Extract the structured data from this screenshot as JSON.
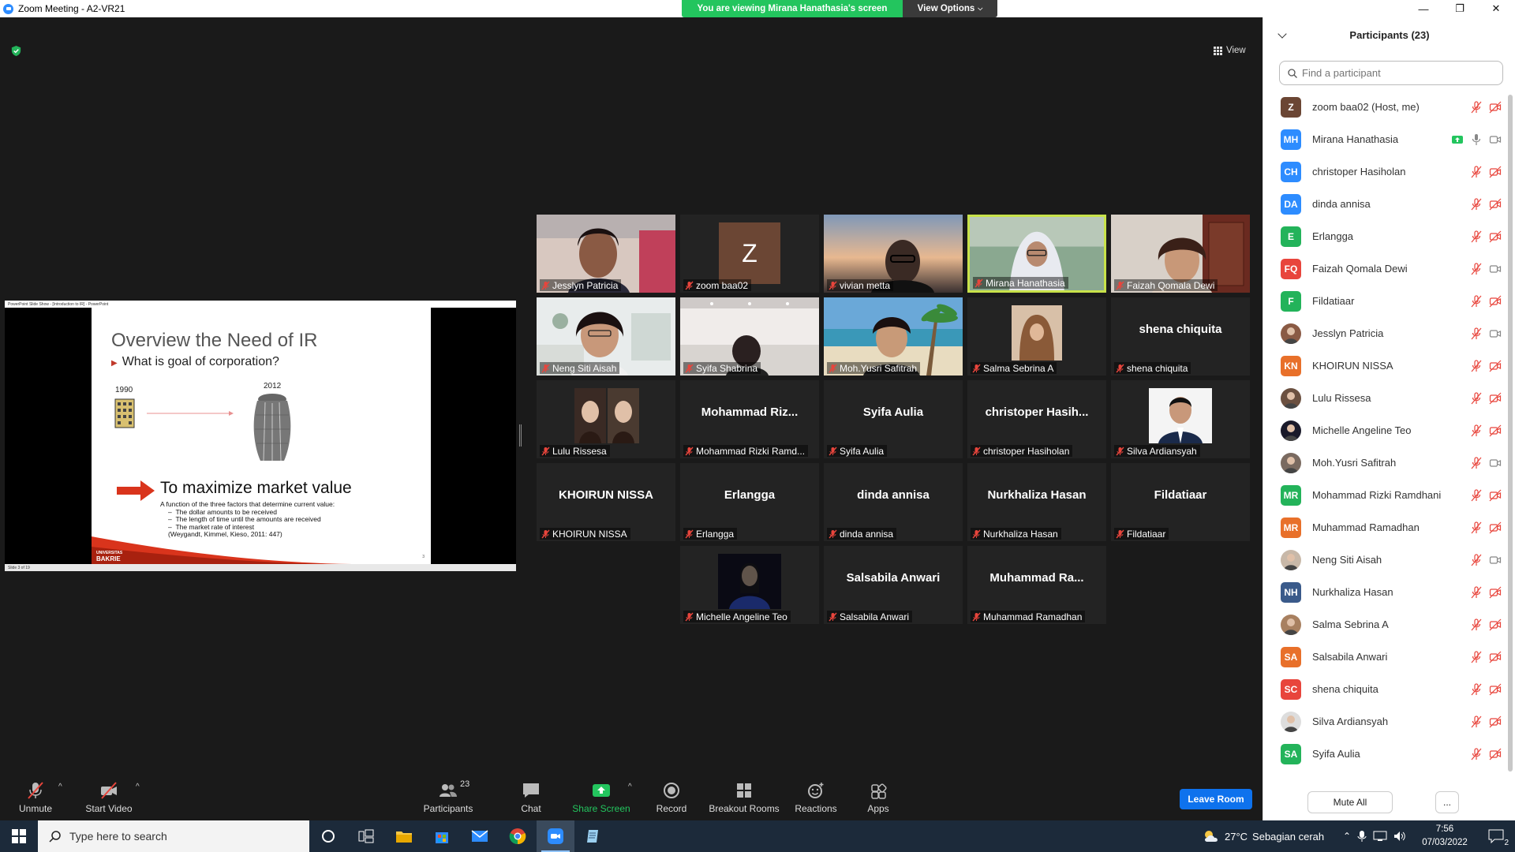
{
  "window": {
    "title": "Zoom Meeting - A2-VR21",
    "minimize": "—",
    "maximize": "❐",
    "close": "✕"
  },
  "banner": {
    "viewing": "You are viewing Mirana Hanathasia's screen",
    "view_options": "View Options"
  },
  "view_button": "View",
  "shared_screen": {
    "window_caption": "PowerPoint Slide Show - [Introduction to IR] - PowerPoint",
    "status": "Slide 3 of 19",
    "slide": {
      "title": "Overview the Need of IR",
      "bullet": "What is goal of corporation?",
      "year_left": "1990",
      "year_right": "2012",
      "headline": "To maximize market value",
      "description": "A function of the three factors that determine current value:",
      "points": [
        "The dollar amounts to be received",
        "The length of time until the amounts are received",
        "The market rate of interest"
      ],
      "citation": "(Weygandt, Kimmel, Kieso, 2011: 447)",
      "logo_line1": "UNIVERSITAS",
      "logo_line2": "BAKRIE",
      "page_number": "3"
    }
  },
  "gallery": [
    {
      "label": "Jesslyn Patricia",
      "kind": "video",
      "scene": "warm"
    },
    {
      "label": "zoom baa02",
      "kind": "avatar",
      "initial": "Z"
    },
    {
      "label": "vivian metta",
      "kind": "video",
      "scene": "sunset"
    },
    {
      "label": "Mirana Hanathasia",
      "kind": "video",
      "scene": "green",
      "active": true
    },
    {
      "label": "Faizah Qomala Dewi",
      "kind": "video",
      "scene": "door"
    },
    {
      "label": "Neng Siti Aisah",
      "kind": "video",
      "scene": "bright"
    },
    {
      "label": "Syifa Shabrina",
      "kind": "video",
      "scene": "studio"
    },
    {
      "label": "Moh.Yusri Safitrah",
      "kind": "video",
      "scene": "beach"
    },
    {
      "label": "Salma Sebrina A",
      "kind": "photo",
      "scene": "hijab"
    },
    {
      "label": "shena chiquita",
      "kind": "name",
      "big": "shena chiquita"
    },
    {
      "label": "Lulu Rissesa",
      "kind": "photo",
      "scene": "duo"
    },
    {
      "label": "Mohammad Rizki Ramd...",
      "kind": "name",
      "big": "Mohammad  Riz..."
    },
    {
      "label": "Syifa Aulia",
      "kind": "name",
      "big": "Syifa Aulia"
    },
    {
      "label": "christoper Hasiholan",
      "kind": "name",
      "big": "christoper  Hasih..."
    },
    {
      "label": "Silva Ardiansyah",
      "kind": "photo",
      "scene": "formal"
    },
    {
      "label": "KHOIRUN NISSA",
      "kind": "name",
      "big": "KHOIRUN NISSA"
    },
    {
      "label": "Erlangga",
      "kind": "name",
      "big": "Erlangga"
    },
    {
      "label": "dinda annisa",
      "kind": "name",
      "big": "dinda annisa"
    },
    {
      "label": "Nurkhaliza Hasan",
      "kind": "name",
      "big": "Nurkhaliza Hasan"
    },
    {
      "label": "Fildatiaar",
      "kind": "name",
      "big": "Fildatiaar"
    },
    {
      "label": "Michelle Angeline Teo",
      "kind": "photo",
      "scene": "dark"
    },
    {
      "label": "Salsabila Anwari",
      "kind": "name",
      "big": "Salsabila Anwari"
    },
    {
      "label": "Muhammad Ramadhan",
      "kind": "name",
      "big": "Muhammad  Ra..."
    }
  ],
  "participants_panel": {
    "title": "Participants (23)",
    "search_placeholder": "Find a participant",
    "mute_all": "Mute All",
    "more": "...",
    "list": [
      {
        "name": "zoom baa02 (Host, me)",
        "initials": "Z",
        "color": "#6b4634",
        "video": false,
        "muted": true
      },
      {
        "name": "Mirana Hanathasia",
        "initials": "MH",
        "color": "#2d8cff",
        "video": true,
        "muted": false,
        "sharing": true
      },
      {
        "name": "christoper Hasiholan",
        "initials": "CH",
        "color": "#2d8cff",
        "video": false,
        "muted": true
      },
      {
        "name": "dinda annisa",
        "initials": "DA",
        "color": "#2d8cff",
        "video": false,
        "muted": true
      },
      {
        "name": "Erlangga",
        "initials": "E",
        "color": "#23b35a",
        "video": false,
        "muted": true
      },
      {
        "name": "Faizah Qomala Dewi",
        "initials": "FQ",
        "color": "#e8453c",
        "video": true,
        "muted": true
      },
      {
        "name": "Fildatiaar",
        "initials": "F",
        "color": "#23b35a",
        "video": false,
        "muted": true
      },
      {
        "name": "Jesslyn Patricia",
        "initials": "",
        "color": "#8a5a44",
        "video": true,
        "muted": true,
        "photo": true
      },
      {
        "name": "KHOIRUN NISSA",
        "initials": "KN",
        "color": "#e8702a",
        "video": false,
        "muted": true
      },
      {
        "name": "Lulu Rissesa",
        "initials": "",
        "color": "#6b5040",
        "video": false,
        "muted": true,
        "photo": true
      },
      {
        "name": "Michelle Angeline Teo",
        "initials": "",
        "color": "#1a1a2a",
        "video": false,
        "muted": true,
        "photo": true
      },
      {
        "name": "Moh.Yusri Safitrah",
        "initials": "",
        "color": "#7a6a60",
        "video": true,
        "muted": true,
        "photo": true
      },
      {
        "name": "Mohammad Rizki Ramdhani",
        "initials": "MR",
        "color": "#23b35a",
        "video": false,
        "muted": true
      },
      {
        "name": "Muhammad Ramadhan",
        "initials": "MR",
        "color": "#e8702a",
        "video": false,
        "muted": true
      },
      {
        "name": "Neng Siti Aisah",
        "initials": "",
        "color": "#c8b8a8",
        "video": true,
        "muted": true,
        "photo": true
      },
      {
        "name": "Nurkhaliza Hasan",
        "initials": "NH",
        "color": "#3a5a8a",
        "video": false,
        "muted": true
      },
      {
        "name": "Salma Sebrina A",
        "initials": "",
        "color": "#a88060",
        "video": false,
        "muted": true,
        "photo": true
      },
      {
        "name": "Salsabila Anwari",
        "initials": "SA",
        "color": "#e8702a",
        "video": false,
        "muted": true
      },
      {
        "name": "shena chiquita",
        "initials": "SC",
        "color": "#e8453c",
        "video": false,
        "muted": true
      },
      {
        "name": "Silva Ardiansyah",
        "initials": "",
        "color": "#ddd",
        "video": false,
        "muted": true,
        "photo": true
      },
      {
        "name": "Syifa Aulia",
        "initials": "SA",
        "color": "#23b35a",
        "video": false,
        "muted": true
      }
    ]
  },
  "toolbar": {
    "unmute": "Unmute",
    "start_video": "Start Video",
    "participants": "Participants",
    "participants_count": "23",
    "chat": "Chat",
    "share_screen": "Share Screen",
    "record": "Record",
    "breakout": "Breakout Rooms",
    "reactions": "Reactions",
    "apps": "Apps",
    "leave": "Leave Room",
    "caret": "^"
  },
  "taskbar": {
    "search_placeholder": "Type here to search",
    "temperature": "27°C",
    "weather": "Sebagian cerah",
    "time": "7:56",
    "date": "07/03/2022",
    "notifications": "2"
  },
  "colors": {
    "accent": "#0e72ed",
    "share_green": "#23c55e",
    "active_speaker": "#c8e24a",
    "muted_red": "#e8453c"
  }
}
